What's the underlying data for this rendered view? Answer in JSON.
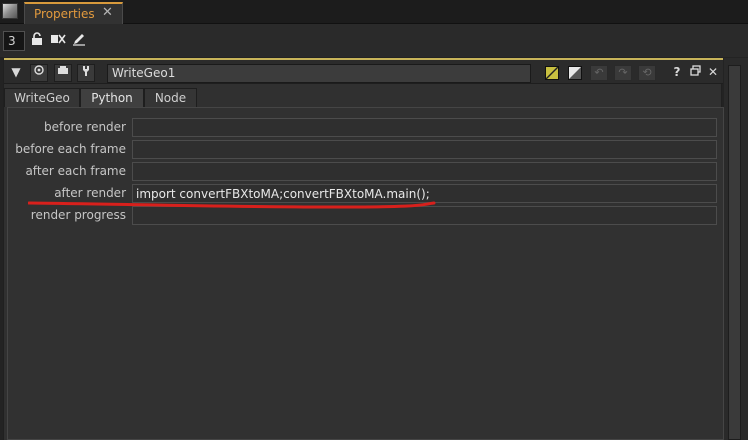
{
  "panel": {
    "tab_label": "Properties",
    "close_glyph": "✕"
  },
  "toolbar": {
    "max_panels": "3",
    "icons": [
      "lock-icon",
      "clear-icon",
      "edit-icon"
    ]
  },
  "node": {
    "name": "WriteGeo1",
    "header_icons": [
      "collapse-icon",
      "viewer-icon",
      "node-graph-icon",
      "settings-icon",
      "help-icon",
      "float-icon",
      "close-icon"
    ],
    "colors": {
      "node_color": "#c8c040",
      "gl_color": "#e8e8e8"
    }
  },
  "tabs": [
    {
      "label": "WriteGeo",
      "active": false
    },
    {
      "label": "Python",
      "active": true
    },
    {
      "label": "Node",
      "active": false
    }
  ],
  "knobs": [
    {
      "label": "before render",
      "value": ""
    },
    {
      "label": "before each frame",
      "value": ""
    },
    {
      "label": "after each frame",
      "value": ""
    },
    {
      "label": "after render",
      "value": "import convertFBXtoMA;convertFBXtoMA.main();"
    },
    {
      "label": "render progress",
      "value": ""
    }
  ],
  "annotation": {
    "color": "#d8201c"
  }
}
